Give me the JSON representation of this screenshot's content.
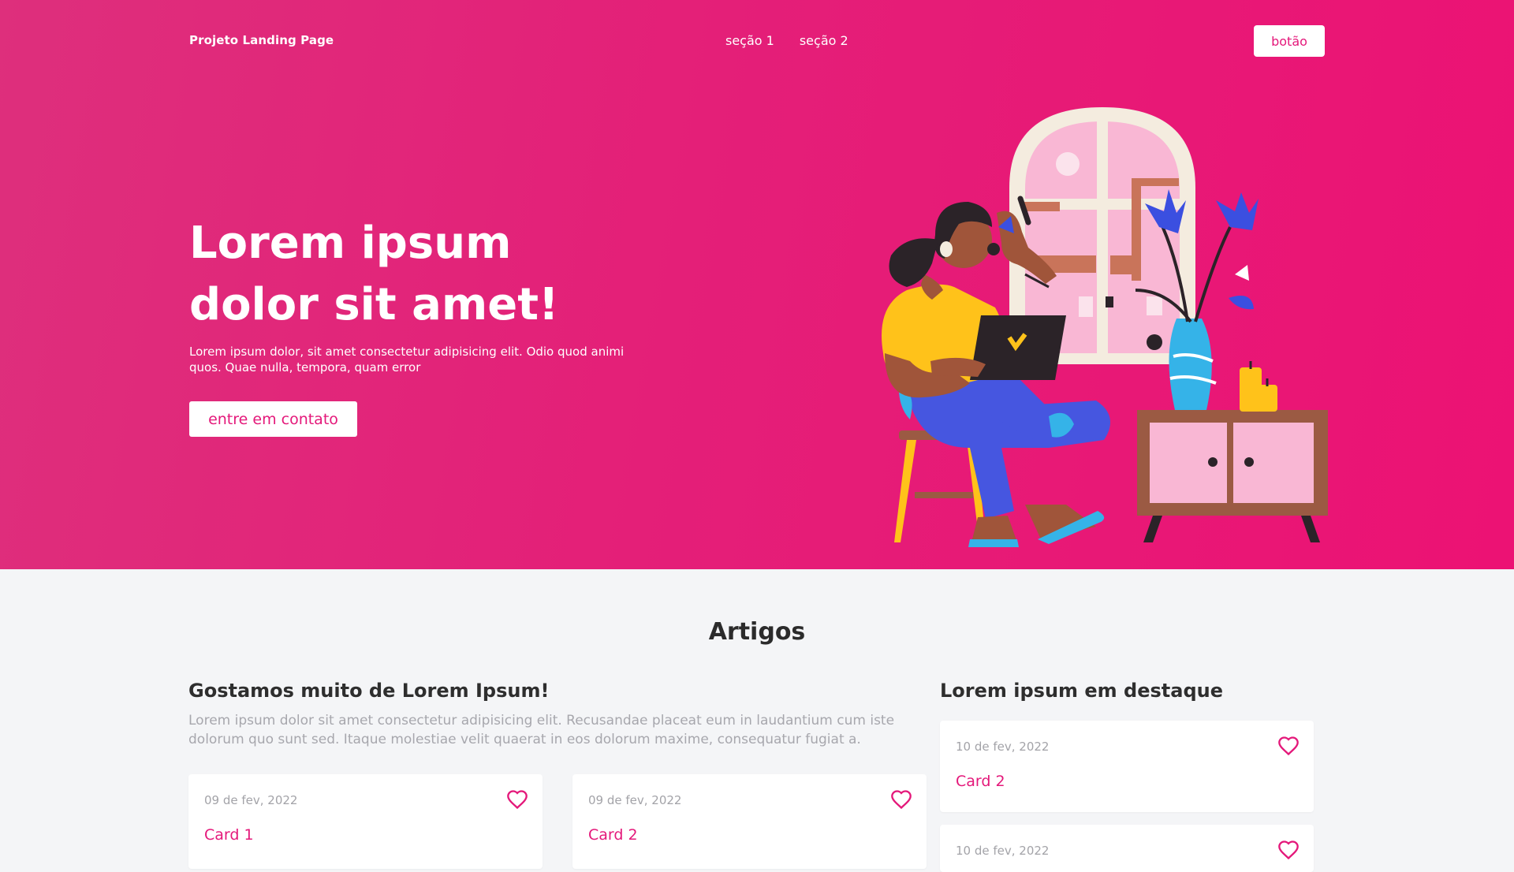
{
  "header": {
    "brand": "Projeto Landing Page",
    "nav": [
      "seção 1",
      "seção 2"
    ],
    "button_label": "botão"
  },
  "hero": {
    "title_line1": "Lorem ipsum",
    "title_line2": "dolor sit amet!",
    "subtitle": "Lorem ipsum dolor, sit amet consectetur adipisicing elit. Odio quod animi quos. Quae nulla, tempora, quam error",
    "cta_label": "entre em contato"
  },
  "articles": {
    "title": "Artigos",
    "main": {
      "title": "Gostamos muito de Lorem Ipsum!",
      "description": "Lorem ipsum dolor sit amet consectetur adipisicing elit. Recusandae placeat eum in laudantium cum iste dolorum quo sunt sed. Itaque molestiae velit quaerat in eos dolorum maxime, consequatur fugiat a.",
      "cards": [
        {
          "date": "09 de fev, 2022",
          "title": "Card 1",
          "icon": "heart-icon"
        },
        {
          "date": "09 de fev, 2022",
          "title": "Card 2",
          "icon": "heart-icon"
        }
      ]
    },
    "featured": {
      "title": "Lorem ipsum em destaque",
      "cards": [
        {
          "date": "10 de fev, 2022",
          "title": "Card 2",
          "icon": "heart-icon"
        },
        {
          "date": "10 de fev, 2022",
          "title": "",
          "icon": "heart-icon"
        }
      ]
    }
  },
  "colors": {
    "accent": "#e4187a",
    "hero_gradient_start": "#de2f7c",
    "hero_gradient_end": "#ec1274",
    "background": "#f4f5f7"
  }
}
